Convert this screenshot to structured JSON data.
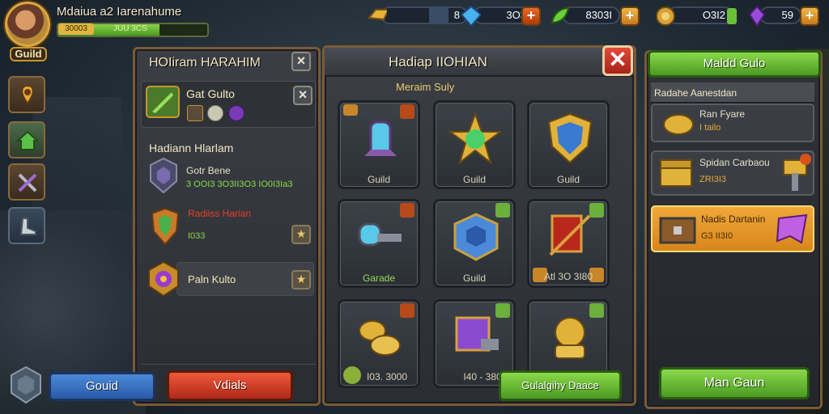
{
  "player": {
    "name": "Mdaiua a2 Iarenahume",
    "badge": "30003",
    "bar_text": "JUU 3CS",
    "level_label": "Guild",
    "bar_fill": 0.68
  },
  "resources": [
    {
      "icon": "gold-bar-icon",
      "value": "8"
    },
    {
      "icon": "blue-gem-icon",
      "value": "3O3"
    },
    {
      "icon": "green-leaf-icon",
      "value": "8303I"
    },
    {
      "icon": "coin-icon",
      "value": "O3I2"
    },
    {
      "icon": "purple-crystal-icon",
      "value": "59"
    }
  ],
  "left_panel": {
    "title": "HOIiram HARAHIM",
    "item1": {
      "name": "Gat Gulto"
    },
    "section_title": "Hadiann Hlarlam",
    "row1": {
      "name": "Gotr Bene",
      "sub": "3 OOI3 3O3II3O3 IO0I3Ia3"
    },
    "row2": {
      "name": "Radiiss Harian",
      "sub": "I033"
    },
    "row3": {
      "name": "Paln Kulto"
    },
    "guild_button": "Gouid",
    "red_button": "Vdials"
  },
  "center_panel": {
    "title": "Hadiap IIOHIAN",
    "subtitle": "Meraim Suly",
    "cells": [
      {
        "label": "Guild"
      },
      {
        "label": "Guild"
      },
      {
        "label": "Guild"
      },
      {
        "label": "Garade"
      },
      {
        "label": "Guild"
      },
      {
        "label": "Atl 3O 3I80"
      },
      {
        "label": "I03. 3000"
      },
      {
        "label": "I40 - 380"
      },
      {
        "label": ""
      }
    ],
    "green_button": "Gulalgihy Daace"
  },
  "right_panel": {
    "header": "Maldd Gulo",
    "section": "Radahe Aanestdan",
    "cards": [
      {
        "title": "Ran Fyare",
        "sub": "I tailo"
      },
      {
        "title": "Spidan Carbaou",
        "sub": "ZRI3I3"
      },
      {
        "title": "Nadis Dartanin",
        "sub": "G3 II3I0"
      }
    ],
    "bottom_button": "Man Gaun"
  },
  "colors": {
    "accent_orange": "#f0a838",
    "accent_green": "#6cbc34",
    "accent_red": "#d8321e",
    "accent_blue": "#3a74c4",
    "panel_border": "#7a5a34"
  }
}
